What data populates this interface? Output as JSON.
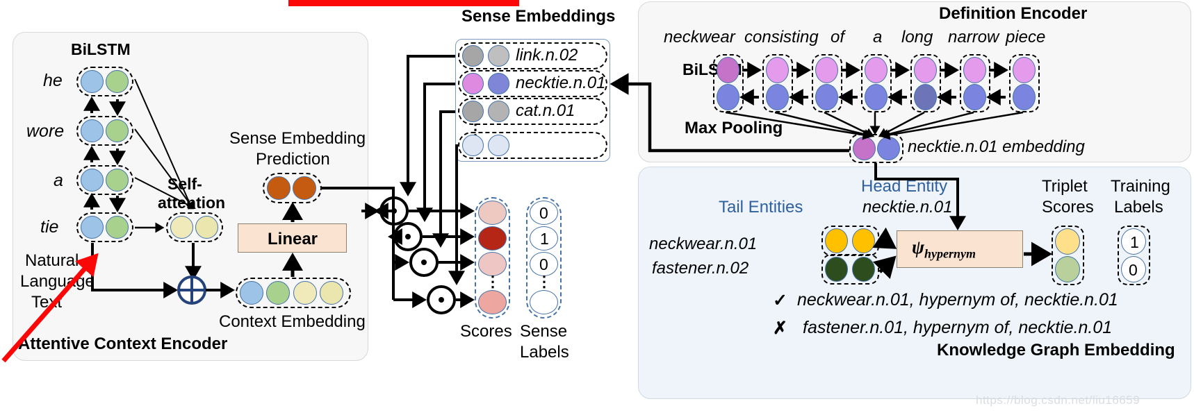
{
  "figure": {
    "title_bar_color": "#fb0707",
    "watermark": "https://blog.csdn.net/liu16659"
  },
  "context_encoder": {
    "panel_label": "Attentive Context Encoder",
    "bilstm_label": "BiLSTM",
    "self_attention_label_line1": "Self-",
    "self_attention_label_line2": "attention",
    "sense_embedding_prediction_line1": "Sense Embedding",
    "sense_embedding_prediction_line2": "Prediction",
    "linear_label": "Linear",
    "context_embedding_label": "Context Embedding",
    "natural_language_text_lines": [
      "Natural",
      "Language",
      "Text"
    ],
    "tokens": [
      "he",
      "wore",
      "a",
      "tie"
    ],
    "token_cell_colors": [
      "#9dc3e6",
      "#a9d18e"
    ],
    "attention_cell_color": "#f0eabb",
    "prediction_cell_color": "#c55a11",
    "context_embedding_colors": [
      "#9dc3e6",
      "#a9d18e",
      "#f0eabb",
      "#ebe5ae"
    ]
  },
  "sense_embeddings": {
    "title": "Sense Embeddings",
    "rows": [
      {
        "label": "link.n.02",
        "colors": [
          "#a6a6a6",
          "#bfbfbf"
        ]
      },
      {
        "label": "necktie.n.01",
        "colors": [
          "#dd8ae0",
          "#7f86d8"
        ]
      },
      {
        "label": "cat.n.01",
        "colors": [
          "#a6a6a6",
          "#b3b3b3"
        ]
      },
      {
        "label": "",
        "colors": [
          "#dde6f2",
          "#dde6f2"
        ]
      }
    ],
    "ellipsis": "⋮"
  },
  "scoring": {
    "operator_symbol": "·",
    "scores_label": "Scores",
    "sense_labels_label_line1": "Sense",
    "sense_labels_label_line2": "Labels",
    "score_colors": [
      "#edc9c2",
      "#b52617",
      "#eec7c4",
      "#eda7a0"
    ],
    "sense_label_values": [
      "0",
      "1",
      "0",
      ""
    ],
    "ellipsis": "⋮"
  },
  "definition_encoder": {
    "panel_label": "Definition Encoder",
    "bilstm_label": "BiLSTM",
    "max_pooling_label": "Max Pooling",
    "words": [
      "neckwear",
      "consisting",
      "of",
      "a",
      "long",
      "narrow",
      "piece"
    ],
    "forward_color": "#e49bec",
    "backward_color": "#7b85e0",
    "embedding_label": "necktie.n.01 embedding",
    "embedding_colors": [
      "#c473c9",
      "#7b85e0"
    ]
  },
  "kg_embedding": {
    "panel_label": "Knowledge Graph Embedding",
    "tail_entities_label": "Tail Entities",
    "head_entity_label": "Head Entity",
    "head_entity_value": "necktie.n.01",
    "triplet_scores_label_line1": "Triplet",
    "triplet_scores_label_line2": "Scores",
    "training_labels_label_line1": "Training",
    "training_labels_label_line2": "Labels",
    "tails": [
      {
        "label": "neckwear.n.01",
        "color": "#ffc000"
      },
      {
        "label": "fastener.n.02",
        "color": "#2d4d1e"
      }
    ],
    "psi_symbol": "ψ",
    "psi_subscript": "hypernym",
    "triplet_score_colors": [
      "#ffe08a",
      "#b9cf9c"
    ],
    "training_label_values": [
      "1",
      "0"
    ],
    "facts": [
      {
        "mark": "✓",
        "text": "neckwear.n.01, hypernym of, necktie.n.01"
      },
      {
        "mark": "✗",
        "text": "fastener.n.01, hypernym of, necktie.n.01"
      }
    ],
    "accent_text_color": "#2e5f9e"
  }
}
